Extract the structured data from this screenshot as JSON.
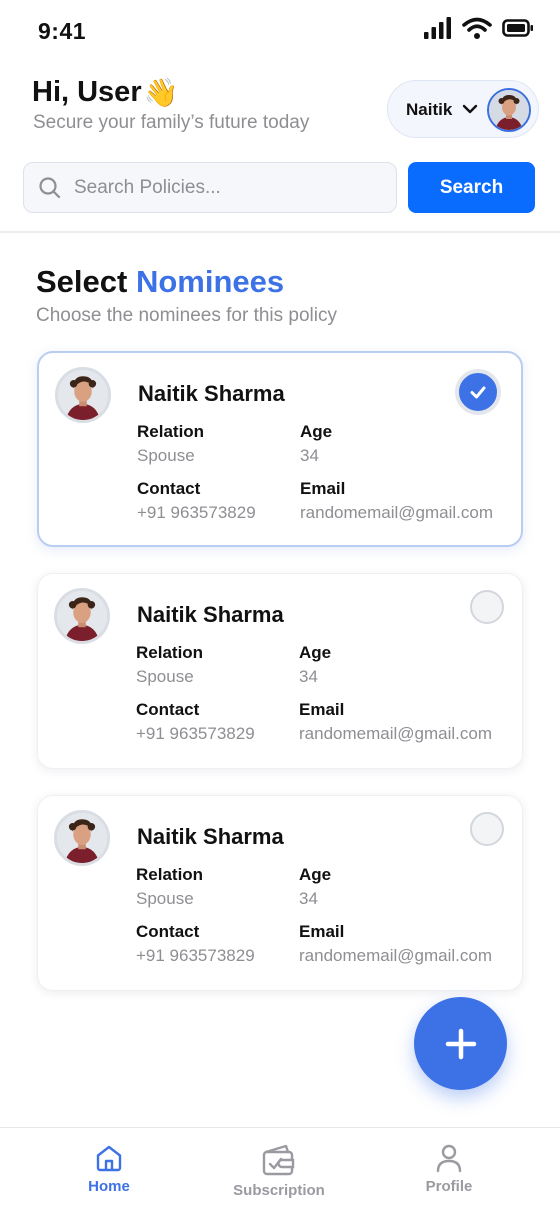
{
  "status_bar": {
    "time": "9:41"
  },
  "header": {
    "greeting": "Hi, User",
    "greeting_emoji": "👋",
    "subtitle": "Secure your family’s future today",
    "user_name": "Naitik"
  },
  "search": {
    "placeholder": "Search Policies...",
    "value": "",
    "button_label": "Search"
  },
  "section": {
    "title_prefix": "Select",
    "title_accent": "Nominees",
    "subtitle": "Choose the nominees for this policy"
  },
  "nominees": [
    {
      "name": "Naitik Sharma",
      "relation_label": "Relation",
      "relation": "Spouse",
      "age_label": "Age",
      "age": "34",
      "contact_label": "Contact",
      "contact": "+91 963573829",
      "email_label": "Email",
      "email": "randomemail@gmail.com",
      "selected": true
    },
    {
      "name": "Naitik Sharma",
      "relation_label": "Relation",
      "relation": "Spouse",
      "age_label": "Age",
      "age": "34",
      "contact_label": "Contact",
      "contact": "+91 963573829",
      "email_label": "Email",
      "email": "randomemail@gmail.com",
      "selected": false
    },
    {
      "name": "Naitik Sharma",
      "relation_label": "Relation",
      "relation": "Spouse",
      "age_label": "Age",
      "age": "34",
      "contact_label": "Contact",
      "contact": "+91 963573829",
      "email_label": "Email",
      "email": "randomemail@gmail.com",
      "selected": false
    }
  ],
  "fab": {
    "icon": "plus-icon"
  },
  "bottom_nav": [
    {
      "label": "Home",
      "icon": "home-icon",
      "active": true
    },
    {
      "label": "Subscription",
      "icon": "wallet-icon",
      "active": false
    },
    {
      "label": "Profile",
      "icon": "person-icon",
      "active": false
    }
  ],
  "colors": {
    "accent": "#3d72e6",
    "search_button": "#0a6cff",
    "muted_text": "#8e8e93"
  }
}
